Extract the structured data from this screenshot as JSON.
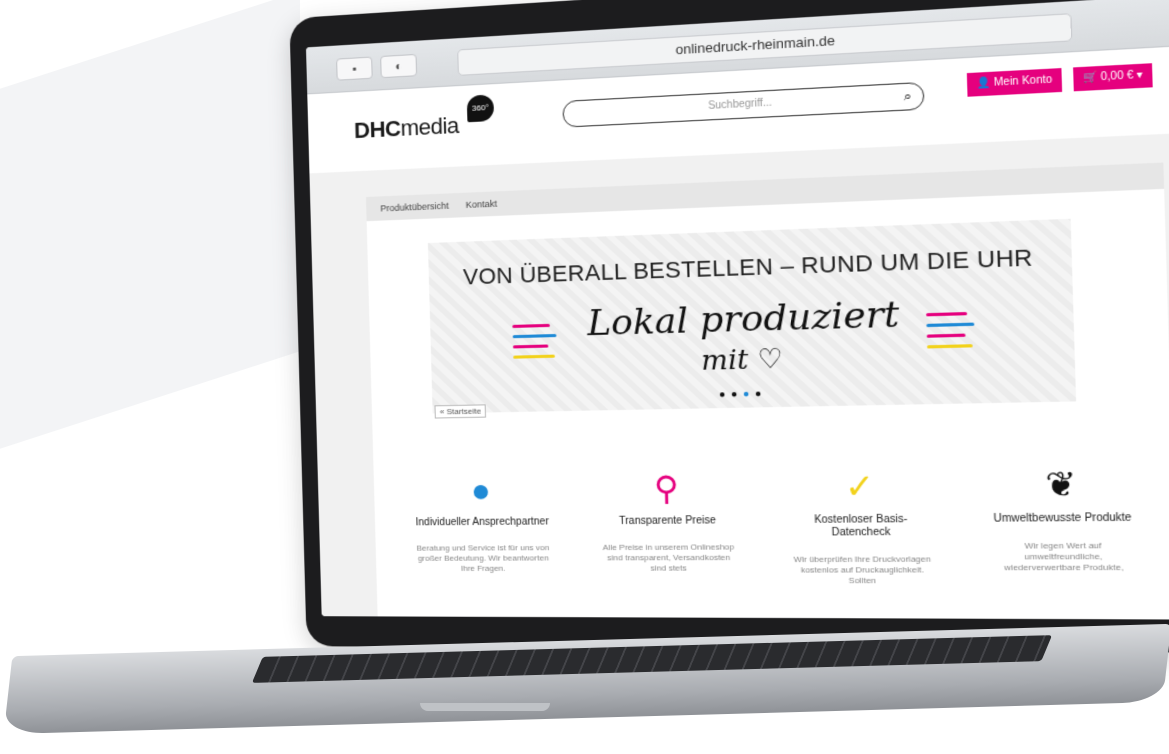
{
  "browser": {
    "url": "onlinedruck-rheinmain.de",
    "reload_icon": "reload-icon"
  },
  "header": {
    "logo_bold": "DHC",
    "logo_light": "media",
    "logo_badge": "360°",
    "search_placeholder": "Suchbegriff...",
    "account_label": "Mein Konto",
    "cart_label": "0,00 € ▾"
  },
  "nav": {
    "items": [
      "Produktübersicht",
      "Kontakt"
    ]
  },
  "banner": {
    "title": "VON ÜBERALL BESTELLEN – RUND UM DIE UHR",
    "script_line1": "Lokal produziert",
    "script_line2": "mit ♡",
    "back_link": "« Startseite"
  },
  "features": [
    {
      "icon": "chat-bubble-icon",
      "title": "Individueller Ansprechpartner",
      "text": "Beratung und Service ist für uns von großer Bedeutung. Wir beantworten Ihre Fragen.",
      "color": "#1f8ad6"
    },
    {
      "icon": "magnifier-icon",
      "title": "Transparente Preise",
      "text": "Alle Preise in unserem Onlineshop sind transparent, Versandkosten sind stets",
      "color": "#e5007e"
    },
    {
      "icon": "checkmark-icon",
      "title": "Kostenloser Basis-Datencheck",
      "text": "Wir überprüfen Ihre Druckvorlagen kostenlos auf Druckauglichkeit. Sollten",
      "color": "#f2d21b"
    },
    {
      "icon": "leaf-icon",
      "title": "Umweltbewusste Produkte",
      "text": "Wir legen Wert auf umweltfreundliche, wiederverwertbare Produkte,",
      "color": "#111111"
    }
  ],
  "colors": {
    "accent": "#e5007e"
  }
}
